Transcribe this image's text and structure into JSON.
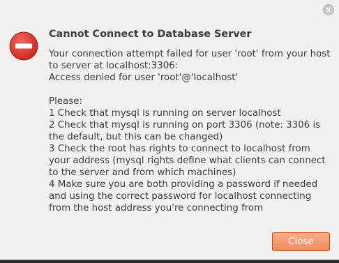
{
  "dialog": {
    "heading": "Cannot Connect to Database Server",
    "message": "Your connection attempt failed for user 'root' from your host to server at localhost:3306:\n  Access denied for user 'root'@'localhost'\n\nPlease:\n1 Check that mysql is running on server localhost\n2 Check that mysql is running on port 3306 (note: 3306 is the default, but this can be changed)\n3 Check the root has rights to connect to localhost from your address (mysql rights define what clients can connect to the server and from which machines)\n4 Make sure you are both providing a password if needed and using the correct password for localhost connecting from the host address you're connecting from",
    "close_button_label": "Close",
    "icons": {
      "status": "error-icon",
      "window_close": "close-icon"
    },
    "colors": {
      "button_accent": "#ee8a5f",
      "error_red": "#df382c"
    }
  }
}
